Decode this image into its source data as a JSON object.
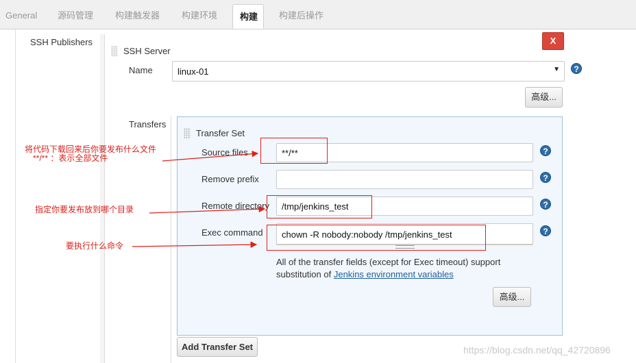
{
  "tabs": [
    "General",
    "源码管理",
    "构建触发器",
    "构建环境",
    "构建",
    "构建后操作"
  ],
  "active_tab_index": 4,
  "section": {
    "title": "SSH Publishers",
    "delete_label": "X"
  },
  "ssh_server": {
    "title": "SSH Server",
    "name_label": "Name",
    "name_value": "linux-01",
    "advanced_label": "高级...",
    "transfers_label": "Transfers"
  },
  "transfer_set": {
    "title": "Transfer Set",
    "source_files_label": "Source files",
    "source_files_value": "**/**",
    "remove_prefix_label": "Remove prefix",
    "remove_prefix_value": "",
    "remote_directory_label": "Remote directory",
    "remote_directory_value": "/tmp/jenkins_test",
    "exec_command_label": "Exec command",
    "exec_command_value": "chown -R nobody:nobody /tmp/jenkins_test",
    "note_text": "All of the transfer fields (except for Exec timeout) support",
    "note_text2": "substitution of",
    "note_link": "Jenkins environment variables",
    "advanced_label": "高级...",
    "add_label": "Add Transfer Set"
  },
  "help_glyph": "?",
  "dropdown_arrow": "▼",
  "annotations": {
    "source_line1": "将代码下载回来后你要发布什么文件",
    "source_line2": "**/**   ：表示全部文件",
    "remote": "指定你要发布放到哪个目录",
    "exec": "要执行什么命令"
  },
  "colors": {
    "annotation_red": "#e0201b",
    "delete_red": "#d9483b",
    "help_blue": "#2f6da8",
    "link_blue": "#1f5f9c"
  },
  "watermark": "https://blog.csdn.net/qq_42720896"
}
